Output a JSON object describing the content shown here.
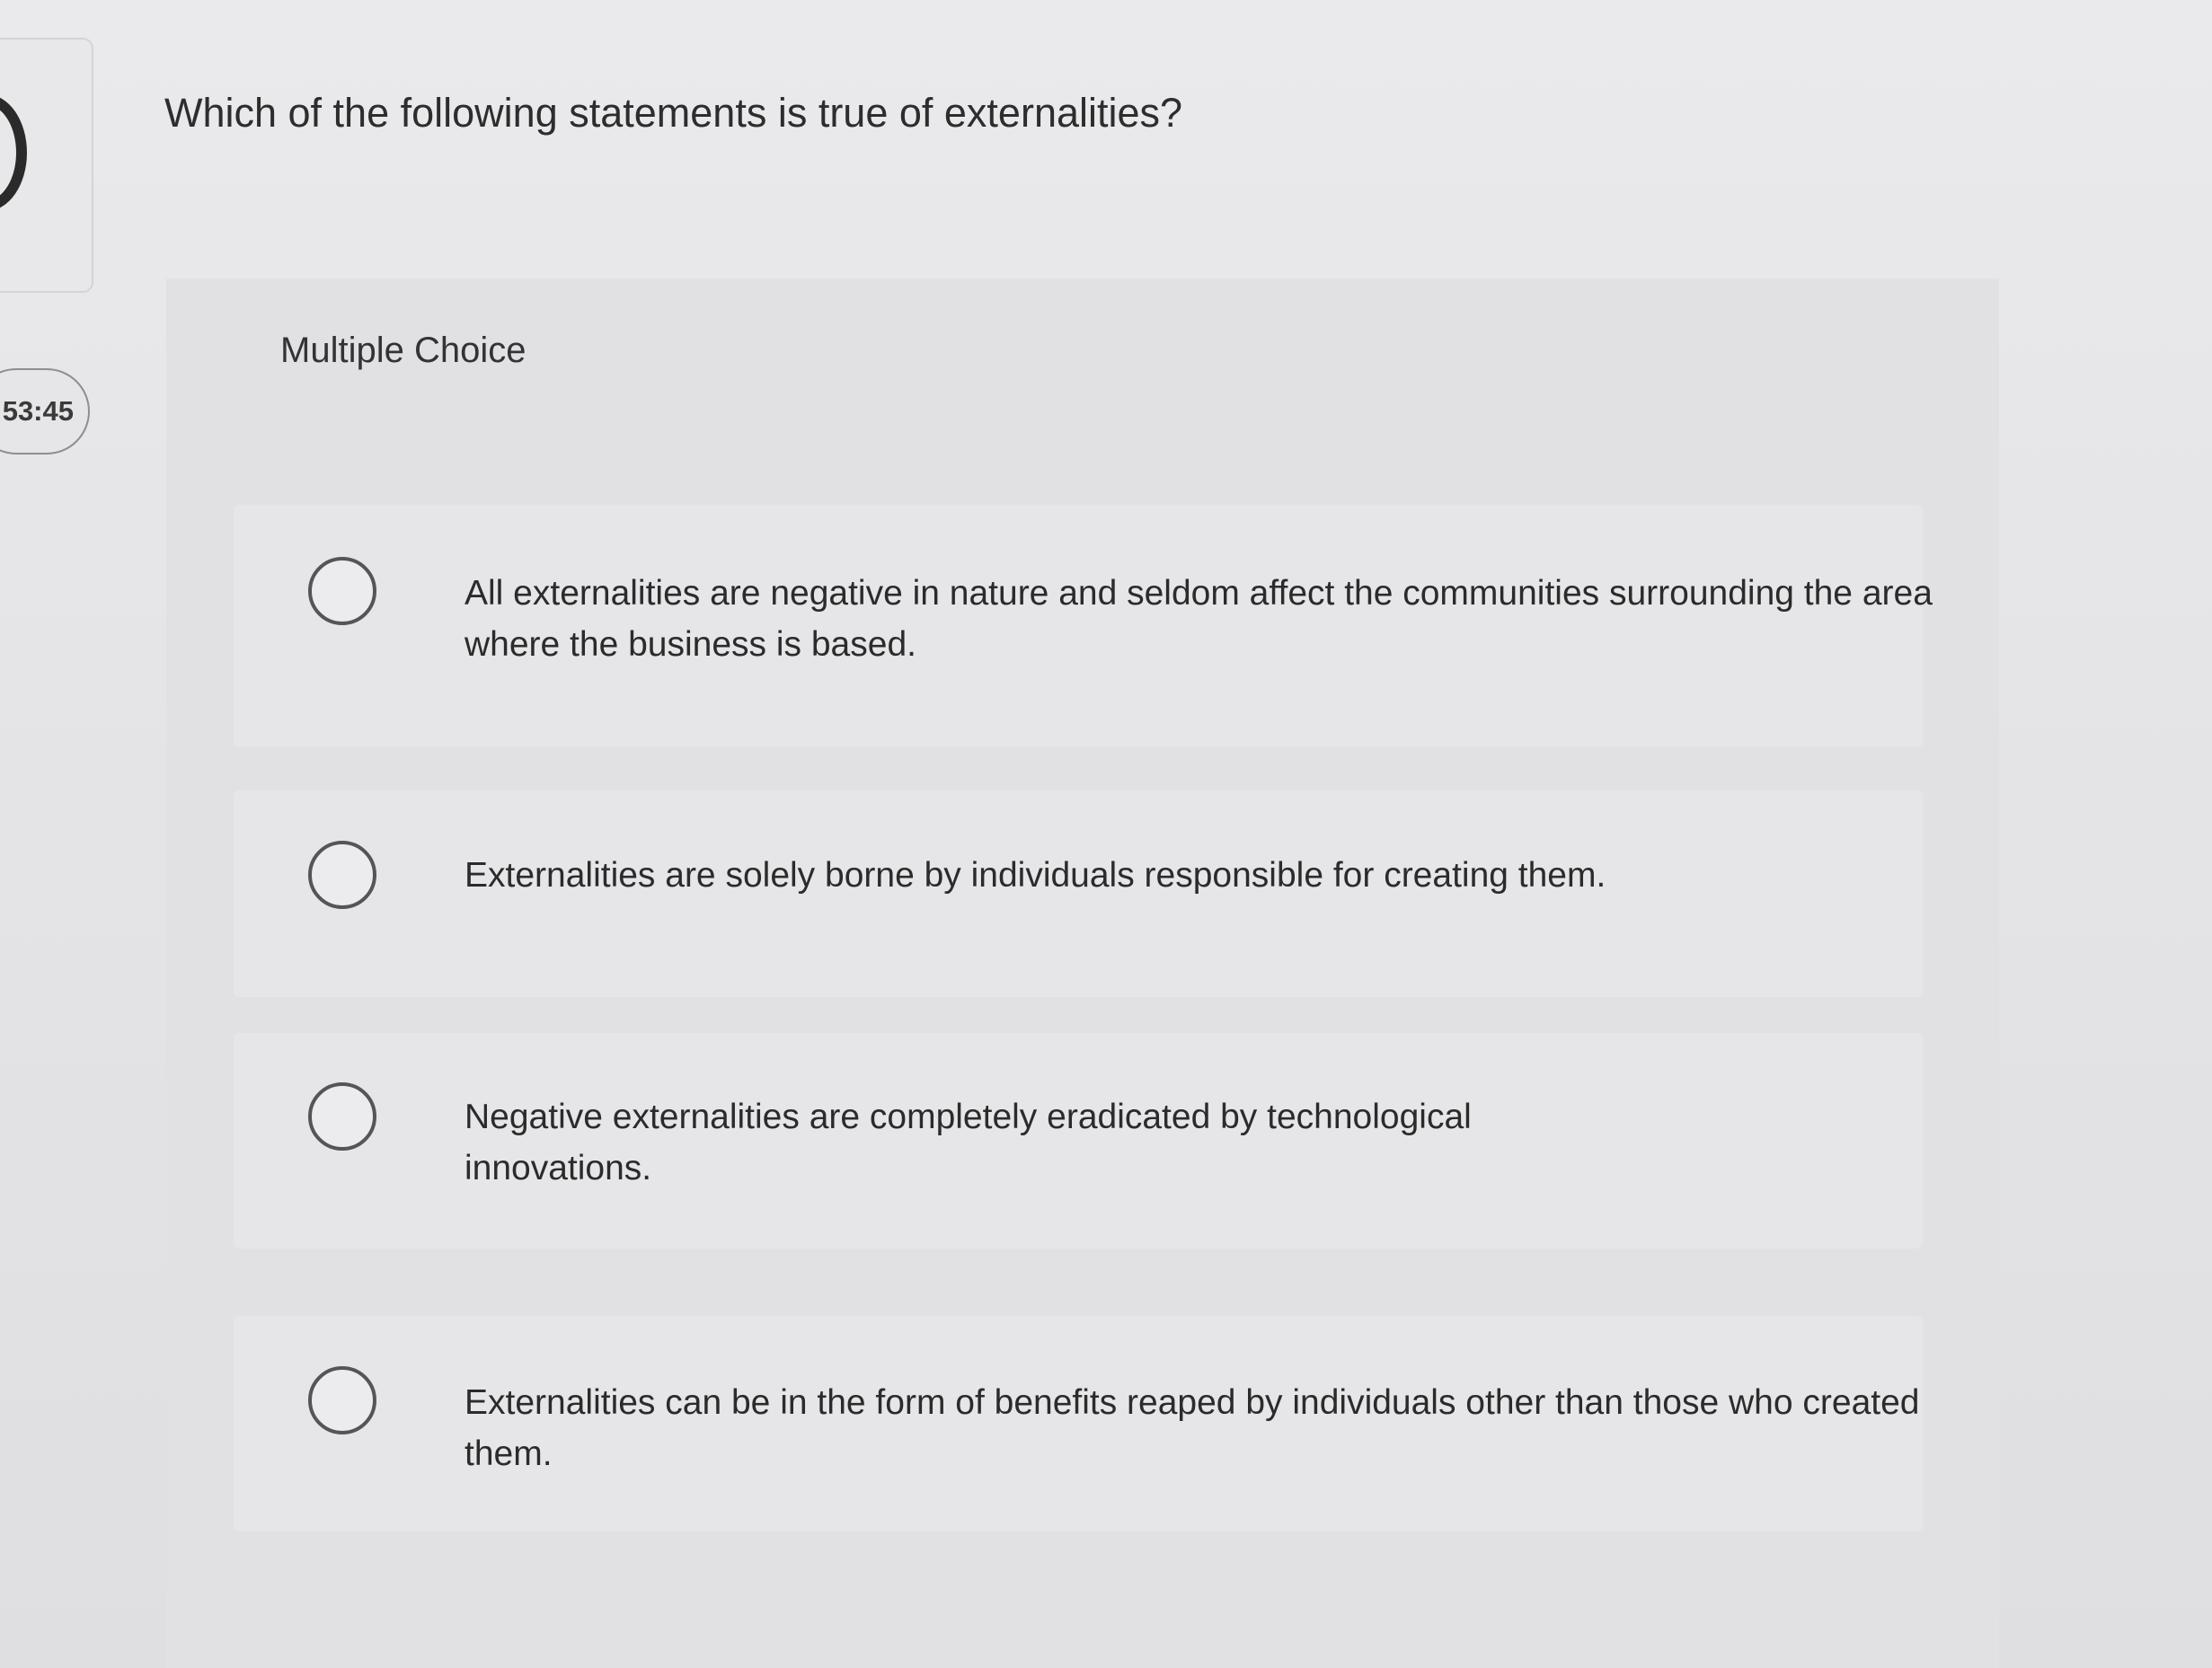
{
  "timer": {
    "text": "53:45"
  },
  "question": {
    "text": "Which of the following statements is true of externalities?"
  },
  "choice_type": "Multiple Choice",
  "options": [
    {
      "text": "All externalities are negative in nature and seldom affect the communities surrounding the area where the business is based.",
      "selected": false
    },
    {
      "text": "Externalities are solely borne by individuals responsible for creating them.",
      "selected": false
    },
    {
      "text": "Negative externalities are completely eradicated by technological innovations.",
      "selected": false
    },
    {
      "text": "Externalities can be in the form of benefits reaped by individuals other than those who created them.",
      "selected": false
    }
  ]
}
